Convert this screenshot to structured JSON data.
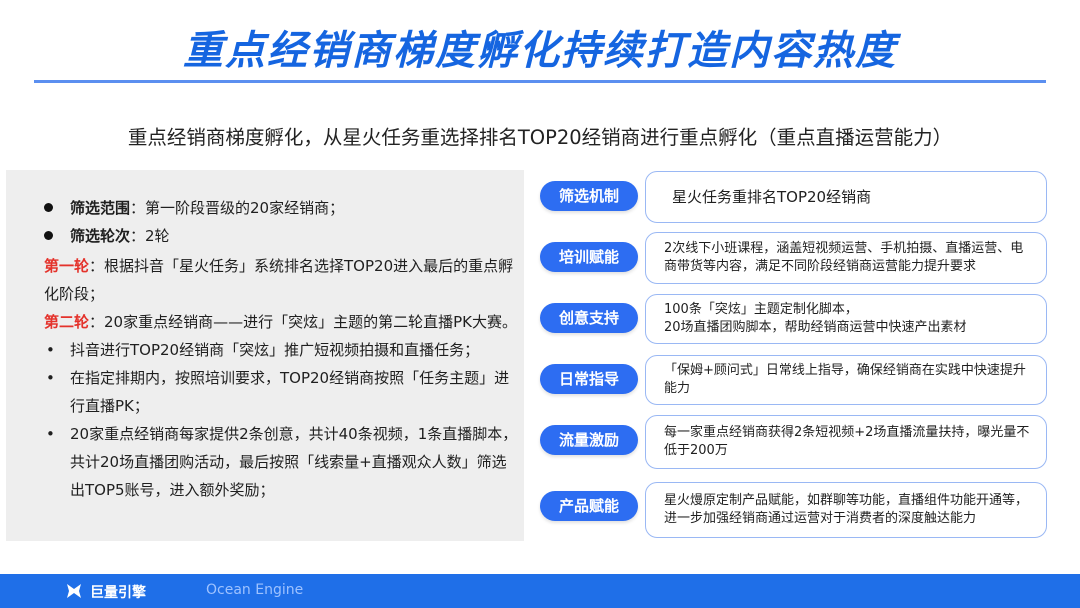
{
  "title": "重点经销商梯度孵化持续打造内容热度",
  "subtitle": "重点经销商梯度孵化，从星火任务重选择排名TOP20经销商进行重点孵化（重点直播运营能力）",
  "left": {
    "range_label": "筛选范围",
    "range_text": "：第一阶段晋级的20家经销商；",
    "rounds_label": "筛选轮次",
    "rounds_text": "：2轮",
    "round1_label": "第一轮",
    "round1_text": "：根据抖音「星火任务」系统排名选择TOP20进入最后的重点孵化阶段；",
    "round2_label": "第二轮",
    "round2_text": "：20家重点经销商——进行「突炫」主题的第二轮直播PK大赛。",
    "bullets": [
      "抖音进行TOP20经销商「突炫」推广短视频拍摄和直播任务；",
      "在指定排期内，按照培训要求，TOP20经销商按照「任务主题」进行直播PK；",
      "20家重点经销商每家提供2条创意，共计40条视频，1条直播脚本，共计20场直播团购活动，最后按照「线索量+直播观众人数」筛选出TOP5账号，进入额外奖励；"
    ]
  },
  "items": [
    {
      "tag": "筛选机制",
      "text": "星火任务重排名TOP20经销商"
    },
    {
      "tag": "培训赋能",
      "text": "2次线下小班课程，涵盖短视频运营、手机拍摄、直播运营、电商带货等内容，满足不同阶段经销商运营能力提升要求"
    },
    {
      "tag": "创意支持",
      "text": "100条「突炫」主题定制化脚本，\n20场直播团购脚本，帮助经销商运营中快速产出素材"
    },
    {
      "tag": "日常指导",
      "text": "「保姆+顾问式」日常线上指导，确保经销商在实践中快速提升能力"
    },
    {
      "tag": "流量激励",
      "text": "每一家重点经销商获得2条短视频+2场直播流量扶持，曝光量不低于200万"
    },
    {
      "tag": "产品赋能",
      "text": "星火熳原定制产品赋能，如群聊等功能，直播组件功能开通等，进一步加强经销商通过运营对于消费者的深度触达能力"
    }
  ],
  "footer": {
    "logo_text": "巨量引擎",
    "en_text": "Ocean Engine"
  },
  "colors": {
    "primary": "#1565e0",
    "tag": "#2d6df2",
    "accent_red": "#e4322b",
    "footer": "#1f6fe8"
  }
}
